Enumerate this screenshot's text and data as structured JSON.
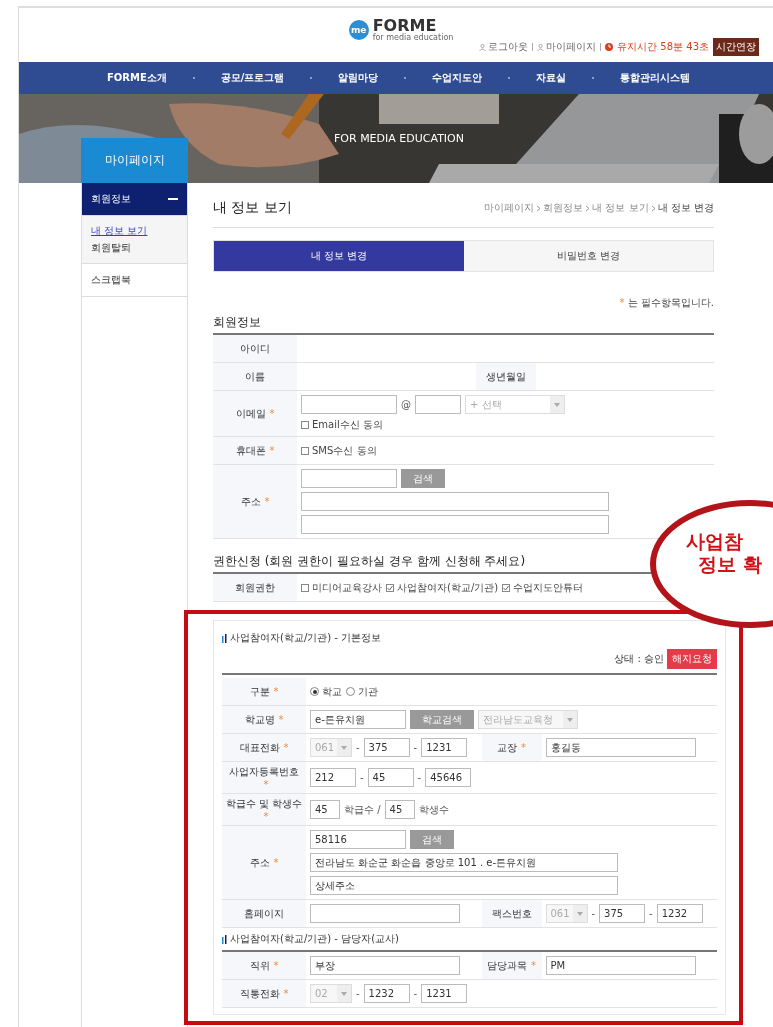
{
  "required_mark": "*",
  "header": {
    "logo": {
      "mark": "me",
      "name": "FORME",
      "tagline": "for media education"
    },
    "links": [
      "로그아웃",
      "마이페이지"
    ],
    "session": {
      "label": "유지시간",
      "time": "58분 43초",
      "button": "시간연장"
    }
  },
  "nav": [
    "FORME소개",
    "공모/프로그램",
    "알림마당",
    "수업지도안",
    "자료실",
    "통합관리시스템"
  ],
  "banner": {
    "kind": "picture",
    "caption": "FOR MEDIA EDUCATION"
  },
  "sidebar": {
    "title": "마이페이지",
    "sections": [
      {
        "label": "회원정보",
        "expanded": true,
        "children": [
          {
            "label": "내 정보 보기",
            "selected": true
          },
          {
            "label": "회원탈퇴",
            "selected": false
          }
        ]
      },
      {
        "label": "스크랩북",
        "expanded": false
      }
    ]
  },
  "page_title": "내 정보 보기",
  "breadcrumb": [
    "마이페이지",
    "회원정보",
    "내 정보 보기",
    "내 정보 변경"
  ],
  "tabs": [
    {
      "label": "내 정보 변경",
      "selected": true
    },
    {
      "label": "비밀번호 변경",
      "selected": false
    }
  ],
  "required_note": "는 필수항목입니다.",
  "member_info": {
    "title": "회원정보",
    "rows": [
      {
        "label": "아이디",
        "required": false,
        "lines": []
      },
      {
        "label": "이름",
        "required": false,
        "lines": [],
        "label2": "생년월일",
        "required2": false,
        "lines2": []
      },
      {
        "label": "이메일",
        "required": true,
        "lines": [
          [
            {
              "kind": "input"
            },
            {
              "kind": "text",
              "text": "@"
            },
            {
              "kind": "short_input"
            },
            {
              "kind": "select",
              "placeholder": "+ 선택"
            }
          ],
          [
            {
              "kind": "check",
              "label": "Email수신 동의",
              "checked": false
            }
          ]
        ]
      },
      {
        "label": "휴대폰",
        "required": true,
        "lines": [
          [
            {
              "kind": "check",
              "label": "SMS수신 동의",
              "checked": false
            }
          ]
        ]
      },
      {
        "label": "주소",
        "required": true,
        "lines": [
          [
            {
              "kind": "input"
            },
            {
              "kind": "button",
              "label": "검색"
            }
          ],
          [
            {
              "kind": "wide_input"
            }
          ],
          [
            {
              "kind": "wide_input"
            }
          ]
        ]
      }
    ]
  },
  "permission": {
    "title": "권한신청 (회원 권한이 필요하실 경우 함께 신청해 주세요)",
    "rows": [
      {
        "label": "회원권한",
        "required": false,
        "lines": [
          [
            {
              "kind": "check",
              "label": "미디어교육강사",
              "checked": false
            },
            {
              "kind": "check",
              "label": "사업참여자(학교/기관)",
              "checked": true
            },
            {
              "kind": "check",
              "label": "수업지도안튜터",
              "checked": true
            }
          ]
        ]
      }
    ]
  },
  "participant": {
    "title": "사업참여자(학교/기관) - 기본정보",
    "status": "상태 : 승인",
    "cancel_button": "해지요청",
    "rows": [
      {
        "label": "구분",
        "required": true,
        "lines": [
          [
            {
              "kind": "radio",
              "label": "학교",
              "selected": true
            },
            {
              "kind": "radio",
              "label": "기관",
              "selected": false
            }
          ]
        ]
      },
      {
        "label": "학교명",
        "required": true,
        "lines": [
          [
            {
              "kind": "input",
              "value": "e-튼유치원"
            },
            {
              "kind": "button",
              "label": "학교검색"
            },
            {
              "kind": "select",
              "value": "전라남도교육청",
              "disabled": true
            }
          ]
        ]
      },
      {
        "label": "대표전화",
        "required": true,
        "lines": [
          [
            {
              "kind": "select_small",
              "value": "061",
              "disabled": true
            },
            {
              "kind": "sep",
              "text": "-"
            },
            {
              "kind": "short_input",
              "value": "375"
            },
            {
              "kind": "sep",
              "text": "-"
            },
            {
              "kind": "short_input",
              "value": "1231"
            }
          ]
        ],
        "label2": "교장",
        "required2": true,
        "lines2": [
          [
            {
              "kind": "fill_input",
              "value": "홍길동"
            }
          ]
        ]
      },
      {
        "label": "사업자등록번호",
        "required": true,
        "lines": [
          [
            {
              "kind": "short_input",
              "value": "212"
            },
            {
              "kind": "sep",
              "text": "-"
            },
            {
              "kind": "short_input",
              "value": "45"
            },
            {
              "kind": "sep",
              "text": "-"
            },
            {
              "kind": "short_input",
              "value": "45646"
            }
          ]
        ]
      },
      {
        "label": "학급수 및 학생수",
        "required": true,
        "lines": [
          [
            {
              "kind": "tiny_input",
              "value": "45"
            },
            {
              "kind": "text",
              "text": "학급수 /"
            },
            {
              "kind": "tiny_input",
              "value": "45"
            },
            {
              "kind": "text",
              "text": "학생수"
            }
          ]
        ]
      },
      {
        "label": "주소",
        "required": true,
        "lines": [
          [
            {
              "kind": "input",
              "value": "58116"
            },
            {
              "kind": "button",
              "label": "검색"
            }
          ],
          [
            {
              "kind": "wide_input",
              "value": "전라남도 화순군 화순읍 중앙로 101 . e-튼유치원"
            }
          ],
          [
            {
              "kind": "wide_input",
              "value": "상세주소"
            }
          ]
        ]
      },
      {
        "label": "홈페이지",
        "required": false,
        "lines": [
          [
            {
              "kind": "fill_input"
            }
          ]
        ],
        "label2": "팩스번호",
        "required2": false,
        "lines2": [
          [
            {
              "kind": "select_small",
              "value": "061",
              "disabled": true
            },
            {
              "kind": "sep",
              "text": "-"
            },
            {
              "kind": "short_input",
              "value": "375"
            },
            {
              "kind": "sep",
              "text": "-"
            },
            {
              "kind": "short_input",
              "value": "1232"
            }
          ]
        ]
      }
    ]
  },
  "contact": {
    "title": "사업참여자(학교/기관) - 담당자(교사)",
    "rows": [
      {
        "label": "직위",
        "required": true,
        "lines": [
          [
            {
              "kind": "fill_input",
              "value": "부장"
            }
          ]
        ],
        "label2": "담당과목",
        "required2": true,
        "lines2": [
          [
            {
              "kind": "fill_input",
              "value": "PM"
            }
          ]
        ]
      },
      {
        "label": "직통전화",
        "required": true,
        "lines": [
          [
            {
              "kind": "select_small",
              "value": "02",
              "disabled": true
            },
            {
              "kind": "sep",
              "text": "-"
            },
            {
              "kind": "short_input",
              "value": "1232"
            },
            {
              "kind": "sep",
              "text": "-"
            },
            {
              "kind": "short_input",
              "value": "1231"
            }
          ]
        ]
      }
    ]
  },
  "callout": {
    "lines": [
      "사업참",
      "정보 확"
    ]
  }
}
